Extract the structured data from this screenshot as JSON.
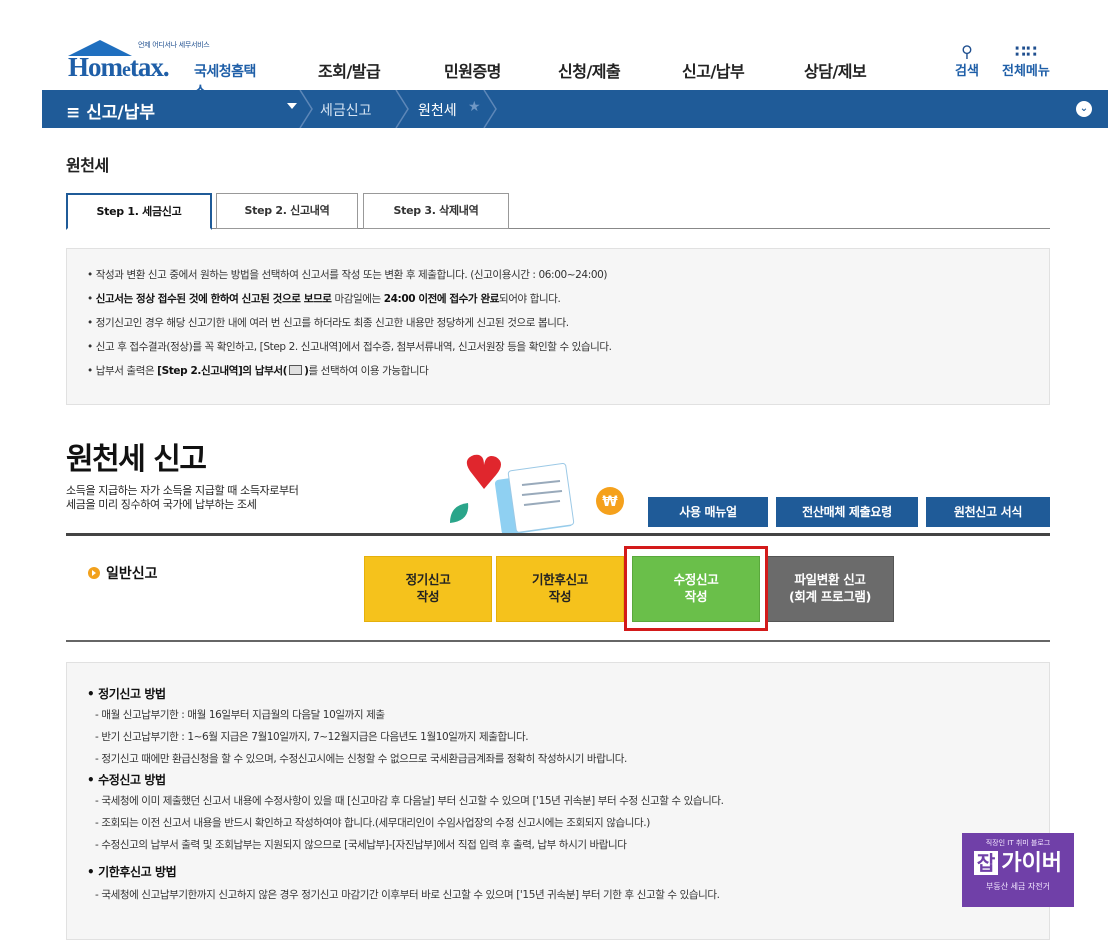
{
  "header": {
    "logo_tiny": "언제 어디서나 세무서비스",
    "logo_home": "Hom",
    "logo_e": "e",
    "logo_tax": "tax.",
    "logo_ko": "국세청홈택스",
    "nav": [
      "조회/발급",
      "민원증명",
      "신청/제출",
      "신고/납부",
      "상담/제보"
    ],
    "search_label": "검색",
    "allmenu_label": "전체메뉴"
  },
  "subnav": {
    "menu_label": "신고/납부",
    "crumb1": "세금신고",
    "crumb2": "원천세"
  },
  "page": {
    "title": "원천세"
  },
  "tabs": [
    {
      "label": "Step 1. 세금신고",
      "active": true
    },
    {
      "label": "Step 2. 신고내역",
      "active": false
    },
    {
      "label": "Step 3. 삭제내역",
      "active": false
    }
  ],
  "info": {
    "line1": "작성과 변환 신고 중에서 원하는 방법을 선택하여 신고서를 작성 또는 변환 후 제출합니다. (신고이용시간 : 06:00~24:00)",
    "line2_b1": "신고서는 정상 접수된 것에 한하여 신고된 것으로 보므로",
    "line2_m": " 마감일에는 ",
    "line2_b2": "24:00 이전에 접수가 완료",
    "line2_e": "되어야 합니다.",
    "line3": "정기신고인 경우 해당 신고기한 내에 여러 번 신고를 하더라도 최종 신고한 내용만 정당하게 신고된 것으로 봅니다.",
    "line4": "신고 후 접수결과(정상)를 꼭 확인하고, [Step 2. 신고내역]에서 접수증, 첨부서류내역, 신고서원장 등을 확인할 수 있습니다.",
    "line5_a": "납부서 출력은 ",
    "line5_b": "[Step 2.신고내역]의 납부서(",
    "line5_c": ")",
    "line5_d": "를 선택하여 이용 가능합니다"
  },
  "section": {
    "heading": "원천세 신고",
    "desc1": "소득을 지급하는 자가 소득을 지급할 때 소득자로부터",
    "desc2": "세금을 미리 징수하여 국가에 납부하는 조세",
    "btn_manual": "사용 매뉴얼",
    "btn_media": "전산매체 제출요령",
    "btn_form": "원천신고 서식",
    "general_label": "일반신고"
  },
  "actions": [
    {
      "line1": "정기신고",
      "line2": "작성"
    },
    {
      "line1": "기한후신고",
      "line2": "작성"
    },
    {
      "line1": "수정신고",
      "line2": "작성"
    },
    {
      "line1": "파일변환 신고",
      "line2": "(회계 프로그램)"
    }
  ],
  "guide": {
    "t1": "정기신고 방법",
    "d1": "- 매월 신고납부기한 : 매월 16일부터 지급월의 다음달 10일까지 제출",
    "d2": "- 반기 신고납부기한 : 1~6월 지급은 7월10일까지, 7~12월지급은 다음년도 1월10일까지 제출합니다.",
    "d3": "- 정기신고 때에만 환급신청을 할 수 있으며, 수정신고시에는 신청할 수 없으므로 국세환급금계좌를 정확히 작성하시기 바랍니다.",
    "t2": "수정신고 방법",
    "d4": "- 국세청에 이미 제출했던 신고서 내용에 수정사항이 있을 때 [신고마감 후 다음날] 부터 신고할 수 있으며 ['15년 귀속분] 부터 수정 신고할 수 있습니다.",
    "d5": "- 조회되는 이전 신고서 내용을 반드시 확인하고 작성하여야 합니다.(세무대리인이 수임사업장의 수정 신고시에는 조회되지 않습니다.)",
    "d6": "- 수정신고의 납부서 출력 및 조회납부는 지원되지 않으므로 [국세납부]-[자진납부]에서 직접 입력 후 출력, 납부 하시기 바랍니다",
    "t3": "기한후신고 방법",
    "d7": "- 국세청에 신고납부기한까지 신고하지 않은 경우 정기신고 마감기간 이후부터 바로 신고할 수 있으며 ['15년 귀속분] 부터 기한 후 신고할 수 있습니다."
  },
  "watermark": {
    "top": "직장인 IT 취미 블로그",
    "jab": "잡",
    "main": "가이버",
    "bottom": "부동산 세금 자전거"
  }
}
